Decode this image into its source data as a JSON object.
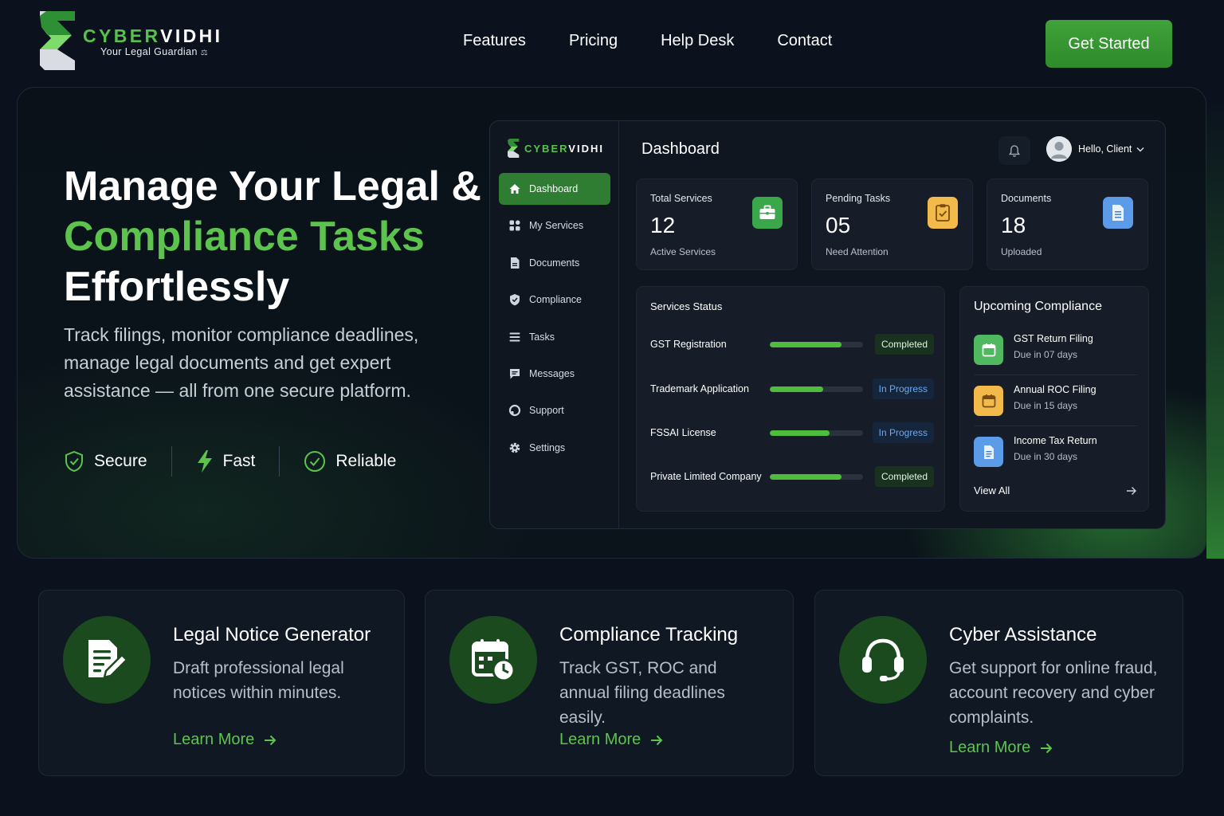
{
  "brand": {
    "name_part1": "CYBER",
    "name_part2": "VIDHI",
    "tagline": "Your Legal Guardian",
    "logo_icon": "cybervidhi-logo-icon"
  },
  "nav": {
    "links": [
      "Features",
      "Pricing",
      "Help Desk",
      "Contact"
    ],
    "cta_label": "Get Started"
  },
  "hero": {
    "title_line1": "Manage Your Legal &",
    "title_line2": "Compliance Tasks",
    "title_line3": "Effortlessly",
    "subtitle": "Track filings, monitor compliance deadlines, manage legal documents and get expert assistance — all from one secure platform.",
    "badges": [
      {
        "label": "Secure",
        "icon": "shield-check-icon"
      },
      {
        "label": "Fast",
        "icon": "lightning-icon"
      },
      {
        "label": "Reliable",
        "icon": "check-circle-icon"
      }
    ],
    "accent_color": "#5cc44d"
  },
  "dashboard": {
    "logo_part1": "CYBER",
    "logo_part2": "VIDHI",
    "title": "Dashboard",
    "user_greeting": "Hello, Client",
    "menu": [
      {
        "label": "Dashboard",
        "icon": "home-icon",
        "active": true
      },
      {
        "label": "My Services",
        "icon": "grid-icon",
        "active": false
      },
      {
        "label": "Documents",
        "icon": "document-icon",
        "active": false
      },
      {
        "label": "Compliance",
        "icon": "shield-icon",
        "active": false
      },
      {
        "label": "Tasks",
        "icon": "list-icon",
        "active": false
      },
      {
        "label": "Messages",
        "icon": "chat-icon",
        "active": false
      },
      {
        "label": "Support",
        "icon": "support-icon",
        "active": false
      },
      {
        "label": "Settings",
        "icon": "gear-icon",
        "active": false
      }
    ],
    "stats": [
      {
        "label": "Total Services",
        "value": "12",
        "sub": "Active Services",
        "icon": "briefcase-icon",
        "color": "#3aa84a"
      },
      {
        "label": "Pending Tasks",
        "value": "05",
        "sub": "Need Attention",
        "icon": "clipboard-icon",
        "color": "#f2b94b"
      },
      {
        "label": "Documents",
        "value": "18",
        "sub": "Uploaded",
        "icon": "file-icon",
        "color": "#5b9be8"
      }
    ],
    "services_status": {
      "title": "Services Status",
      "rows": [
        {
          "name": "GST Registration",
          "progress": 0.77,
          "status": "Completed",
          "kind": "done"
        },
        {
          "name": "Trademark Application",
          "progress": 0.57,
          "status": "In Progress",
          "kind": "prog"
        },
        {
          "name": "FSSAI License",
          "progress": 0.64,
          "status": "In Progress",
          "kind": "prog"
        },
        {
          "name": "Private Limited Company",
          "progress": 0.77,
          "status": "Completed",
          "kind": "done"
        }
      ]
    },
    "upcoming": {
      "title": "Upcoming Compliance",
      "items": [
        {
          "name": "GST Return Filing",
          "due": "Due in 07 days",
          "icon": "calendar-icon",
          "color": "#4fb860"
        },
        {
          "name": "Annual ROC Filing",
          "due": "Due in 15 days",
          "icon": "calendar-icon",
          "color": "#f2b94b"
        },
        {
          "name": "Income Tax Return",
          "due": "Due in 30 days",
          "icon": "file-icon",
          "color": "#5b9be8"
        }
      ],
      "view_all": "View All"
    }
  },
  "features": [
    {
      "title": "Legal Notice Generator",
      "desc": "Draft professional legal notices within minutes.",
      "link": "Learn More",
      "icon": "document-pen-icon"
    },
    {
      "title": "Compliance Tracking",
      "desc": "Track GST, ROC and annual filing deadlines easily.",
      "link": "Learn More",
      "icon": "calendar-clock-icon"
    },
    {
      "title": "Cyber Assistance",
      "desc": "Get support for online fraud, account recovery and cyber complaints.",
      "link": "Learn More",
      "icon": "headset-icon"
    }
  ]
}
